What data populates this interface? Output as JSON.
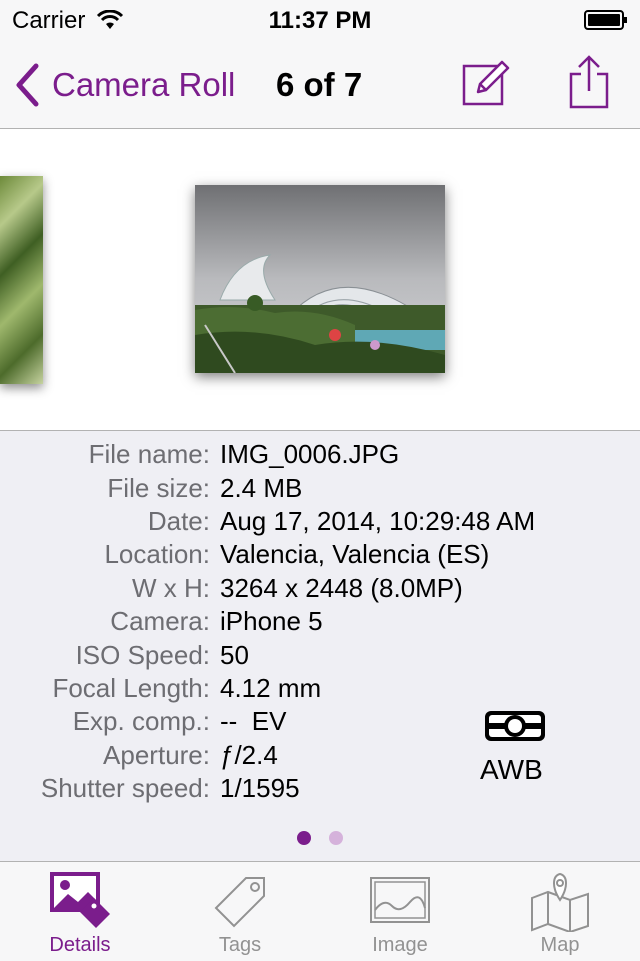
{
  "status_bar": {
    "carrier": "Carrier",
    "time": "11:37 PM"
  },
  "nav": {
    "back_label": "Camera Roll",
    "position": "6 of 7"
  },
  "details": {
    "rows": [
      {
        "label": "File name:",
        "value": "IMG_0006.JPG"
      },
      {
        "label": "File size:",
        "value": "2.4 MB"
      },
      {
        "label": "Date:",
        "value": "Aug 17, 2014, 10:29:48 AM"
      },
      {
        "label": "Location:",
        "value": "Valencia, Valencia (ES)"
      },
      {
        "label": "W x H:",
        "value": "3264 x 2448 (8.0MP)"
      },
      {
        "label": "Camera:",
        "value": "iPhone 5"
      },
      {
        "label": "ISO Speed:",
        "value": "50"
      },
      {
        "label": "Focal Length:",
        "value": "4.12 mm"
      },
      {
        "label": "Exp. comp.:",
        "value": "--  EV"
      },
      {
        "label": "Aperture:",
        "value": "ƒ/2.4"
      },
      {
        "label": "Shutter speed:",
        "value": "1/1595"
      }
    ],
    "white_balance": "AWB",
    "pager": {
      "pages": 2,
      "current": 1
    }
  },
  "tabs": [
    {
      "label": "Details",
      "icon": "details-photo-tag-icon",
      "active": true
    },
    {
      "label": "Tags",
      "icon": "tag-icon",
      "active": false
    },
    {
      "label": "Image",
      "icon": "image-icon",
      "active": false
    },
    {
      "label": "Map",
      "icon": "map-icon",
      "active": false
    }
  ],
  "colors": {
    "accent": "#7b1d8c",
    "inactive": "#929292",
    "details_bg": "#efeff4",
    "bar_bg": "#f7f7f8"
  }
}
